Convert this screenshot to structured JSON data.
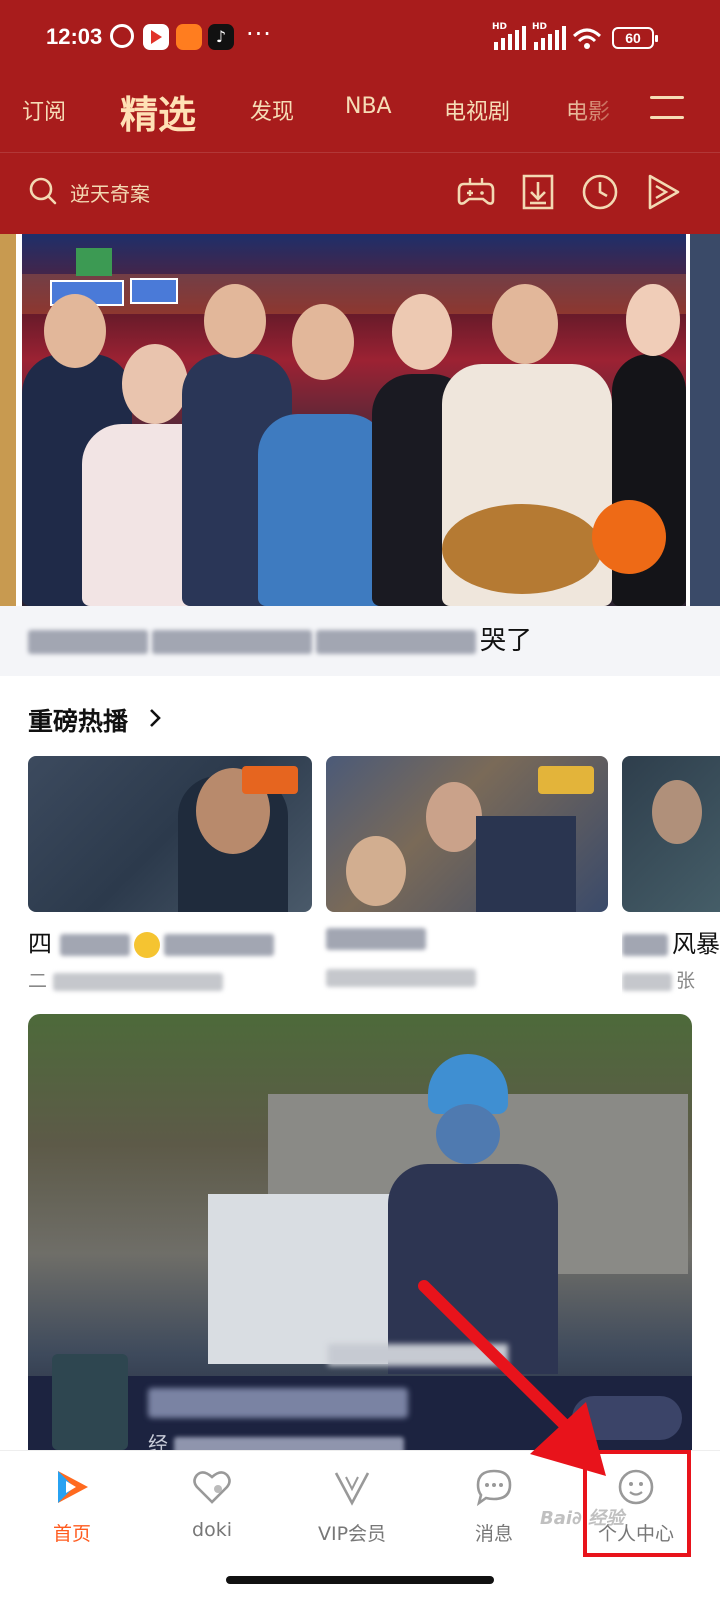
{
  "status_bar": {
    "time": "12:03",
    "more": "···",
    "network_label": "HD",
    "battery": "60"
  },
  "tabs": [
    {
      "label": "订阅"
    },
    {
      "label": "精选"
    },
    {
      "label": "发现"
    },
    {
      "label": "NBA"
    },
    {
      "label": "电视剧"
    },
    {
      "label": "电影"
    }
  ],
  "search": {
    "placeholder": "逆天奇案"
  },
  "banner": {
    "caption_visible": "哭了"
  },
  "section": {
    "title": "重磅热播"
  },
  "cards": [
    {
      "title_visible": "四",
      "subtitle_visible": "二"
    },
    {
      "title_visible": "",
      "subtitle_visible": ""
    },
    {
      "title_visible": "风暴",
      "subtitle_visible": "张"
    }
  ],
  "feed": {
    "subtitle_visible": "经"
  },
  "bottom_nav": [
    {
      "label": "首页",
      "active": true
    },
    {
      "label": "doki",
      "active": false
    },
    {
      "label": "VIP会员",
      "active": false
    },
    {
      "label": "消息",
      "active": false
    },
    {
      "label": "个人中心",
      "active": false
    }
  ],
  "colors": {
    "header_bg": "#a81c1c",
    "tab_text": "#f6dcb6",
    "nav_active": "#ff5b1f",
    "annotation": "#e8131b"
  }
}
